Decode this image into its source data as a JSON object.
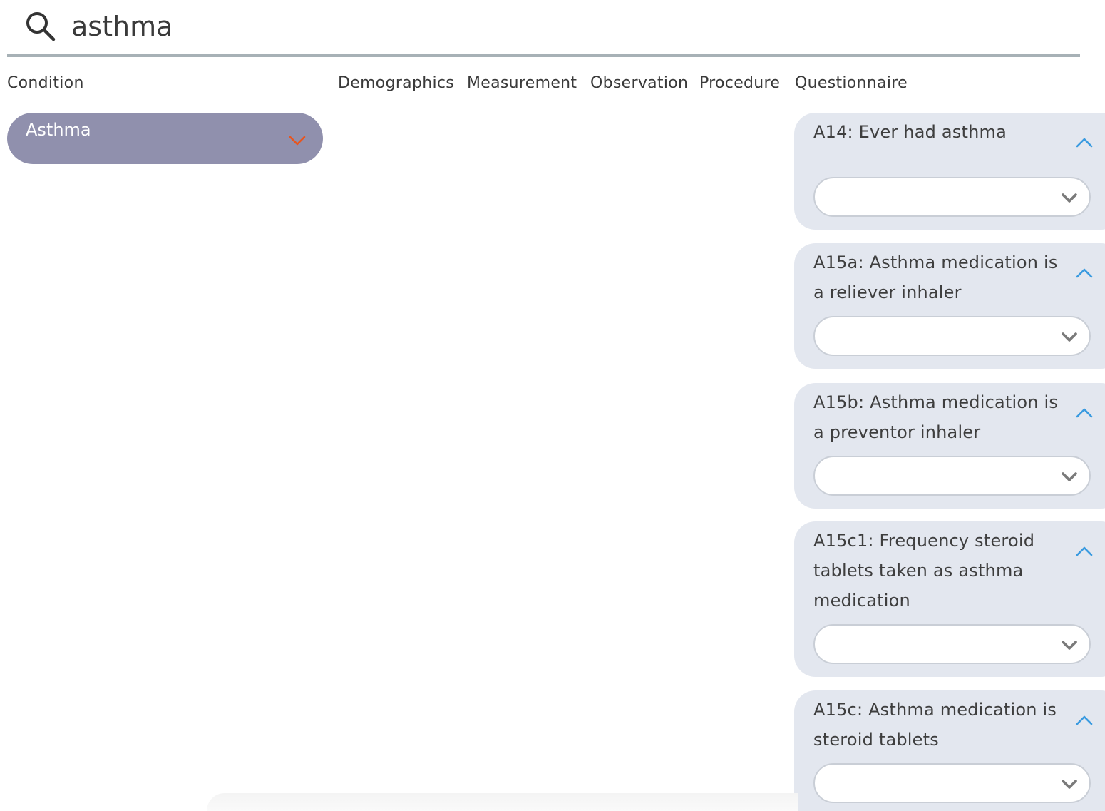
{
  "search": {
    "value": "asthma",
    "icon": "search-icon"
  },
  "categories": {
    "condition": "Condition",
    "demographics": "Demographics",
    "measurement": "Measurement",
    "observation": "Observation",
    "procedure": "Procedure",
    "questionnaire": "Questionnaire"
  },
  "condition_items": [
    {
      "label": "Asthma",
      "icon": "chevron-down-icon",
      "icon_color": "#e8551e"
    }
  ],
  "questionnaire_items": [
    {
      "title": "A14: Ever had asthma",
      "selected": ""
    },
    {
      "title": "A15a: Asthma medication is a reliever inhaler",
      "selected": ""
    },
    {
      "title": "A15b: Asthma medication is a preventor inhaler",
      "selected": ""
    },
    {
      "title": "A15c1: Frequency steroid tablets taken as asthma medication",
      "selected": ""
    },
    {
      "title": "A15c: Asthma medication is steroid tablets",
      "selected": ""
    }
  ],
  "colors": {
    "condition_pill": "#9090ad",
    "card_background": "#e3e7ef",
    "collapse_icon": "#3a9be0",
    "search_underline": "#a7b1b6"
  }
}
